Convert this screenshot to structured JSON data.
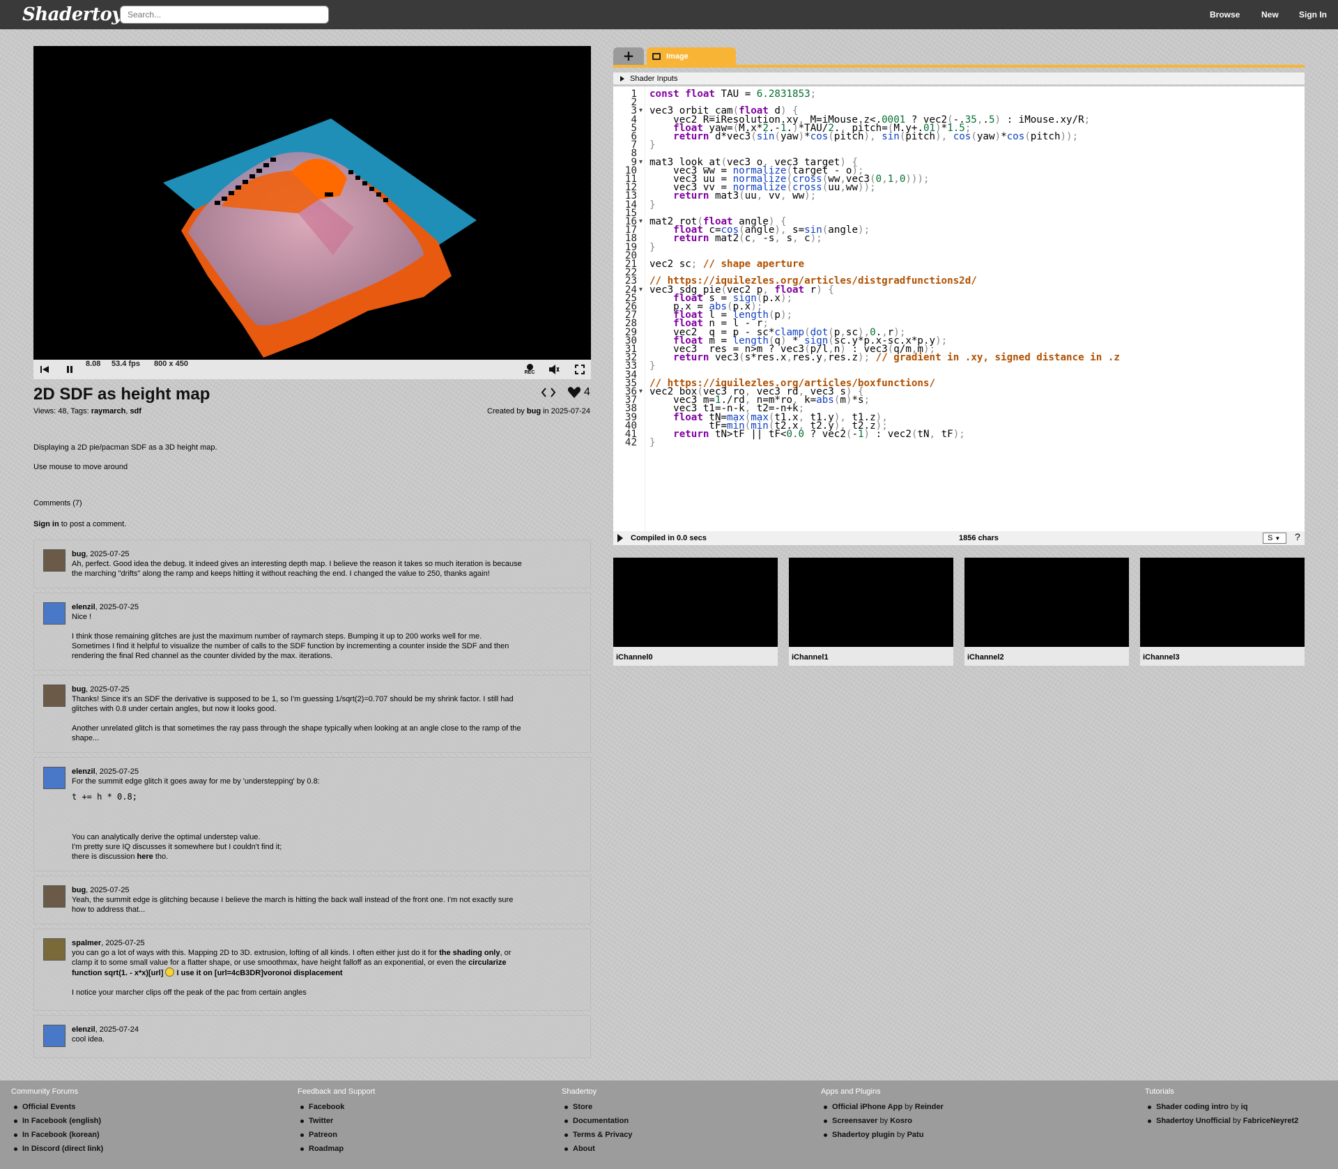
{
  "topbar": {
    "logo": "Shadertoy",
    "search_placeholder": "Search...",
    "nav": [
      "Browse",
      "New",
      "Sign In"
    ]
  },
  "player": {
    "time": "8.08",
    "fps": "53.4 fps",
    "resolution": "800 x 450",
    "rec_label": "REC"
  },
  "shader": {
    "title": "2D SDF as height map",
    "views_label": "Views: 48, Tags: ",
    "tags": [
      "raymarch",
      "sdf"
    ],
    "likes": "4",
    "created_prefix": "Created by ",
    "author": "bug",
    "created_suffix": " in 2025-07-24",
    "description": [
      "Displaying a 2D pie/pacman SDF as a 3D height map.",
      "Use mouse to move around"
    ]
  },
  "comments_section": {
    "header": "Comments (7)",
    "signin_link": "Sign in",
    "signin_rest": " to post a comment."
  },
  "comments": [
    {
      "user": "bug",
      "date": ", 2025-07-25",
      "lines": [
        "Ah, perfect. Good idea the debug. It indeed gives an interesting depth map. I believe the reason it takes so much iteration is because",
        "the marching \"drifts\" along the ramp and keeps hitting it without reaching the end. I changed the value to 250, thanks again!"
      ]
    },
    {
      "user": "elenzil",
      "date": ", 2025-07-25",
      "lines": [
        "Nice !",
        "",
        "I think those remaining glitches are just the maximum number of raymarch steps. Bumping it up to 200 works well for me.",
        "Sometimes I find it helpful to visualize the number of calls to the SDF function by incrementing a counter inside the SDF and then",
        "rendering the final Red channel as the counter divided by the max. iterations."
      ]
    },
    {
      "user": "bug",
      "date": ", 2025-07-25",
      "lines": [
        "Thanks! Since it's an SDF the derivative is supposed to be 1, so I'm guessing 1/sqrt(2)=0.707 should be my shrink factor. I still had",
        "glitches with 0.8 under certain angles, but now it looks good.",
        "",
        "Another unrelated glitch is that sometimes the ray pass through the shape typically when looking at an angle close to the ramp of the",
        "shape..."
      ]
    },
    {
      "user": "elenzil",
      "date": ", 2025-07-25",
      "lines": [
        "For the summit edge glitch it goes away for me by 'understepping' by 0.8:"
      ],
      "code": "t += h * 0.8;",
      "lines2": [
        "You can analytically derive the optimal understep value.",
        "I'm pretty sure IQ discusses it somewhere but I couldn't find it;"
      ],
      "last_prefix": "there is discussion ",
      "last_link": "here",
      "last_suffix": " tho."
    },
    {
      "user": "bug",
      "date": ", 2025-07-25",
      "lines": [
        "Yeah, the summit edge is glitching because I believe the march is hitting the back wall instead of the front one. I'm not exactly sure",
        "how to address that..."
      ]
    },
    {
      "user": "spalmer",
      "date": ", 2025-07-25",
      "l1a": "you can go a lot of ways with this.  Mapping 2D to 3D.  extrusion, lofting of all kinds.  I often either just do it for ",
      "l1b": "the shading only",
      "l1c": ", or",
      "l2a": "clamp it to some small value for a flatter shape, or use smoothmax, have height falloff as an exponential, or even the ",
      "l2b": "circularize",
      "l3a": "function sqrt(1. - x*x)[url]",
      "l3b": " I use it on [url=4cB3DR]voronoi displacement",
      "l4": "I notice your marcher clips off the peak of the pac from certain angles"
    },
    {
      "user": "elenzil",
      "date": ", 2025-07-24",
      "lines": [
        "cool idea."
      ]
    }
  ],
  "editor": {
    "tab_add": "+",
    "tab_image": "Image",
    "shader_inputs": "Shader Inputs",
    "compiled": "Compiled in 0.0 secs",
    "chars": "1856 chars",
    "font_select": "S",
    "help": "?",
    "channels": [
      "iChannel0",
      "iChannel1",
      "iChannel2",
      "iChannel3"
    ]
  },
  "code_lines": [
    "const float TAU = 6.2831853;",
    "",
    "vec3 orbit_cam(float d) {",
    "    vec2 R=iResolution.xy, M=iMouse.z<.0001 ? vec2(-.35,.5) : iMouse.xy/R;",
    "    float yaw=(M.x*2.-1.)*TAU/2., pitch=(M.y+.01)*1.5;",
    "    return d*vec3(sin(yaw)*cos(pitch), sin(pitch), cos(yaw)*cos(pitch));",
    "}",
    "",
    "mat3 look_at(vec3 o, vec3 target) {",
    "    vec3 ww = normalize(target - o);",
    "    vec3 uu = normalize(cross(ww,vec3(0,1,0)));",
    "    vec3 vv = normalize(cross(uu,ww));",
    "    return mat3(uu, vv, ww);",
    "}",
    "",
    "mat2 rot(float angle) {",
    "    float c=cos(angle), s=sin(angle);",
    "    return mat2(c, -s, s, c);",
    "}",
    "",
    "vec2 sc; // shape aperture",
    "",
    "// https://iquilezles.org/articles/distgradfunctions2d/",
    "vec3 sdg_pie(vec2 p, float r) {",
    "    float s = sign(p.x);",
    "    p.x = abs(p.x);",
    "    float l = length(p);",
    "    float n = l - r;",
    "    vec2  q = p - sc*clamp(dot(p,sc),0.,r);",
    "    float m = length(q) * sign(sc.y*p.x-sc.x*p.y);",
    "    vec3  res = n>m ? vec3(p/l,n) : vec3(q/m,m);",
    "    return vec3(s*res.x,res.y,res.z); // gradient in .xy, signed distance in .z",
    "}",
    "",
    "// https://iquilezles.org/articles/boxfunctions/",
    "vec2 box(vec3 ro, vec3 rd, vec3 s) {",
    "    vec3 m=1./rd, n=m*ro, k=abs(m)*s;",
    "    vec3 t1=-n-k, t2=-n+k;",
    "    float tN=max(max(t1.x, t1.y), t1.z),",
    "          tF=min(min(t2.x, t2.y), t2.z);",
    "    return tN>tF || tF<0.0 ? vec2(-1) : vec2(tN, tF);",
    "}"
  ],
  "footer": {
    "columns": [
      {
        "title": "Community Forums",
        "items": [
          [
            "Official Events",
            ""
          ],
          [
            "In Facebook (english)",
            ""
          ],
          [
            "In Facebook (korean)",
            ""
          ],
          [
            "In Discord (direct link)",
            ""
          ]
        ]
      },
      {
        "title": "Feedback and Support",
        "items": [
          [
            "Facebook",
            ""
          ],
          [
            "Twitter",
            ""
          ],
          [
            "Patreon",
            ""
          ],
          [
            "Roadmap",
            ""
          ]
        ]
      },
      {
        "title": "Shadertoy",
        "items": [
          [
            "Store",
            ""
          ],
          [
            "Documentation",
            ""
          ],
          [
            "Terms & Privacy",
            ""
          ],
          [
            "About",
            ""
          ]
        ]
      },
      {
        "title": "Apps and Plugins",
        "items": [
          [
            "Official iPhone App",
            "Reinder"
          ],
          [
            "Screensaver",
            "Kosro"
          ],
          [
            "Shadertoy plugin",
            "Patu"
          ]
        ]
      },
      {
        "title": "Tutorials",
        "items": [
          [
            "Shader coding intro",
            "iq"
          ],
          [
            "Shadertoy Unofficial",
            "FabriceNeyret2"
          ]
        ]
      }
    ],
    "by": " by "
  },
  "colors": {
    "topbar": "#3a3a3a",
    "tab_accent": "#f8b434",
    "footer": "#9c9c9c",
    "keyword": "#8000a0",
    "comment": "#b05000",
    "number": "#007030"
  }
}
